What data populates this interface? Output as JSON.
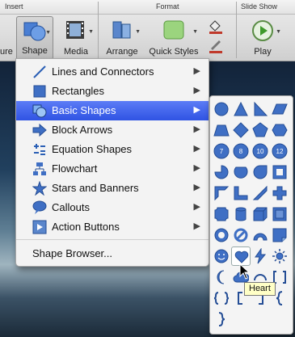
{
  "ribbon": {
    "groups": {
      "insert": "Insert",
      "format": "Format",
      "slide_show": "Slide Show"
    },
    "buttons": {
      "partial_left": "ure",
      "shape": "Shape",
      "media": "Media",
      "arrange": "Arrange",
      "quick_styles": "Quick Styles",
      "play": "Play"
    }
  },
  "menu": {
    "items": [
      {
        "label": "Lines and Connectors",
        "icon": "line-icon"
      },
      {
        "label": "Rectangles",
        "icon": "rectangle-icon"
      },
      {
        "label": "Basic Shapes",
        "icon": "basic-shapes-icon"
      },
      {
        "label": "Block Arrows",
        "icon": "block-arrow-icon"
      },
      {
        "label": "Equation Shapes",
        "icon": "equation-icon"
      },
      {
        "label": "Flowchart",
        "icon": "flowchart-icon"
      },
      {
        "label": "Stars and Banners",
        "icon": "star-icon"
      },
      {
        "label": "Callouts",
        "icon": "callout-icon"
      },
      {
        "label": "Action Buttons",
        "icon": "action-button-icon"
      }
    ],
    "active_index": 2,
    "browser": "Shape Browser..."
  },
  "submenu": {
    "shapes": [
      "oval",
      "triangle",
      "right-triangle",
      "parallelogram",
      "trapezoid",
      "diamond",
      "pentagon",
      "hexagon",
      "heptagon",
      "octagon",
      "decagon",
      "dodecagon",
      "pie",
      "chord",
      "teardrop",
      "frame",
      "half-frame",
      "l-shape",
      "diagonal-stripe",
      "cross",
      "plaque",
      "can",
      "cube",
      "bevel",
      "donut",
      "no-symbol",
      "block-arc",
      "folded-corner",
      "smiley-face",
      "heart",
      "lightning-bolt",
      "sun",
      "moon",
      "cloud",
      "arc",
      "double-bracket",
      "double-brace",
      "left-bracket",
      "right-bracket",
      "left-brace",
      "right-brace"
    ],
    "hovered": "heart",
    "tooltip": "Heart"
  },
  "colors": {
    "accent": "#2f53e3",
    "shape_fill": "#3f6fc4",
    "shape_stroke": "#244d95"
  }
}
